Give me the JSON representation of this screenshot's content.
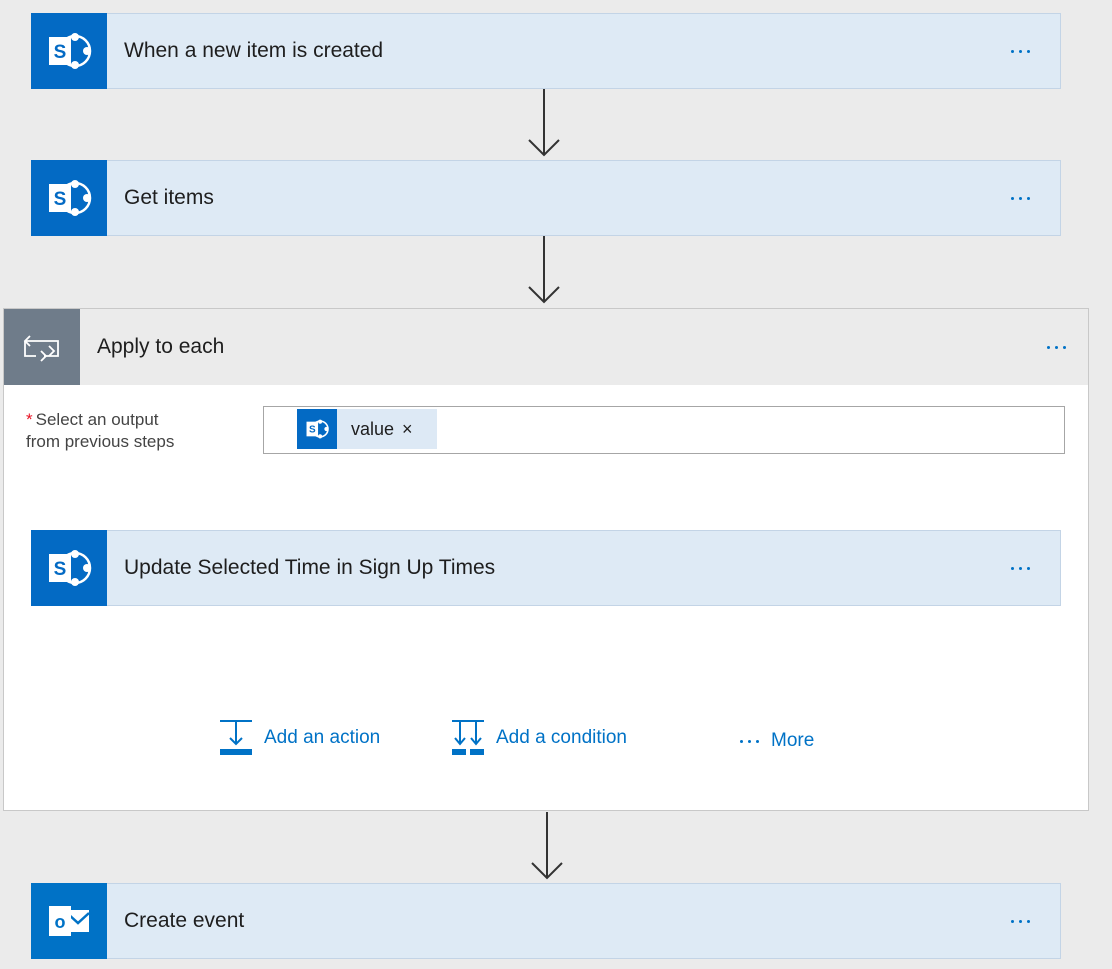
{
  "steps": {
    "trigger": {
      "title": "When a new item is created",
      "icon": "sharepoint-icon"
    },
    "get_items": {
      "title": "Get items",
      "icon": "sharepoint-icon"
    },
    "apply_to_each": {
      "title": "Apply to each",
      "icon": "loop-icon",
      "field": {
        "required_mark": "*",
        "label_line1": "Select an output",
        "label_line2": "from previous steps",
        "token_label": "value",
        "token_remove": "×"
      },
      "inner_step": {
        "title": "Update Selected Time in Sign Up Times",
        "icon": "sharepoint-icon"
      },
      "add_action_label": "Add an action",
      "add_condition_label": "Add a condition",
      "more_label": "More"
    },
    "create_event": {
      "title": "Create event",
      "icon": "outlook-icon"
    }
  },
  "colors": {
    "sharepoint": "#036ac4",
    "outlook": "#0072c6",
    "loop": "#6f7c8a",
    "link": "#0072c6",
    "card_bg": "#deeaf5"
  }
}
